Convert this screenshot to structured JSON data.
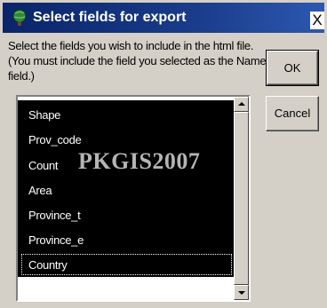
{
  "dialog": {
    "title": "Select fields for export",
    "close_glyph": "X",
    "icon": "globe-icon"
  },
  "instructions": {
    "line1": "Select the fields you wish to include in the html file.",
    "line2": "(You must include the field you selected as the Name",
    "line3": "field.)"
  },
  "buttons": {
    "ok_label": "OK",
    "cancel_label": "Cancel"
  },
  "fields": {
    "items": [
      {
        "label": "Shape",
        "selected": true
      },
      {
        "label": "Prov_code",
        "selected": true
      },
      {
        "label": "Count",
        "selected": true
      },
      {
        "label": "Area",
        "selected": true
      },
      {
        "label": "Province_t",
        "selected": true
      },
      {
        "label": "Province_e",
        "selected": true
      },
      {
        "label": "Country",
        "selected": true,
        "focused": true
      }
    ]
  },
  "watermark": "PKGIS2007",
  "colors": {
    "titlebar": "#0a246a",
    "selection": "#000000",
    "dialog_bg": "#d4d0c8"
  }
}
